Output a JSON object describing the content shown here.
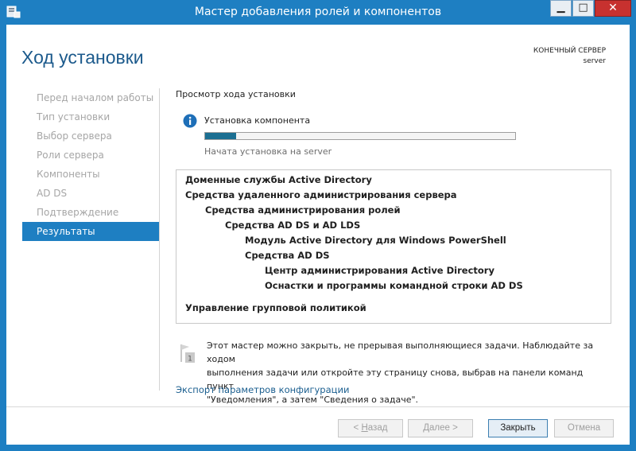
{
  "window": {
    "title": "Мастер добавления ролей и компонентов",
    "controls": {
      "minimize": "▁",
      "maximize": "□",
      "close": "✕"
    }
  },
  "header": {
    "page_title": "Ход установки",
    "destination_label": "КОНЕЧНЫЙ СЕРВЕР",
    "destination_value": "server"
  },
  "sidebar": {
    "items": [
      {
        "label": "Перед началом работы",
        "active": false
      },
      {
        "label": "Тип установки",
        "active": false
      },
      {
        "label": "Выбор сервера",
        "active": false
      },
      {
        "label": "Роли сервера",
        "active": false
      },
      {
        "label": "Компоненты",
        "active": false
      },
      {
        "label": "AD DS",
        "active": false
      },
      {
        "label": "Подтверждение",
        "active": false
      },
      {
        "label": "Результаты",
        "active": true
      }
    ]
  },
  "main": {
    "section_label": "Просмотр хода установки",
    "install_title": "Установка компонента",
    "progress_fraction": 0.1,
    "install_subtitle": "Начата установка на server",
    "results": [
      {
        "label": "Доменные службы Active Directory",
        "level": 0
      },
      {
        "label": "Средства удаленного администрирования сервера",
        "level": 0
      },
      {
        "label": "Средства администрирования ролей",
        "level": 1
      },
      {
        "label": "Средства AD DS и AD LDS",
        "level": 2
      },
      {
        "label": "Модуль Active Directory для Windows PowerShell",
        "level": 3
      },
      {
        "label": "Средства AD DS",
        "level": 3
      },
      {
        "label": "Центр администрирования Active Directory",
        "level": 4
      },
      {
        "label": "Оснастки и программы командной строки AD DS",
        "level": 4
      },
      {
        "label": "Управление групповой политикой",
        "level": 0
      }
    ],
    "note_lines": [
      "Этот мастер можно закрыть, не прерывая выполняющиеся задачи. Наблюдайте за ходом",
      "выполнения задачи или откройте эту страницу снова, выбрав на панели команд пункт",
      "\"Уведомления\", а затем \"Сведения о задаче\"."
    ],
    "note_badge": "1",
    "export_link": "Экспорт параметров конфигурации"
  },
  "buttons": {
    "back_prefix": "< ",
    "back_access": "Н",
    "back_rest": "азад",
    "next_access": "Д",
    "next_rest": "алее >",
    "close": "Закрыть",
    "cancel": "Отмена"
  },
  "colors": {
    "accent": "#1e7fc2",
    "title_text": "#1c5a8c",
    "progress_fill": "#1b6f92",
    "close_button": "#c7312f"
  }
}
